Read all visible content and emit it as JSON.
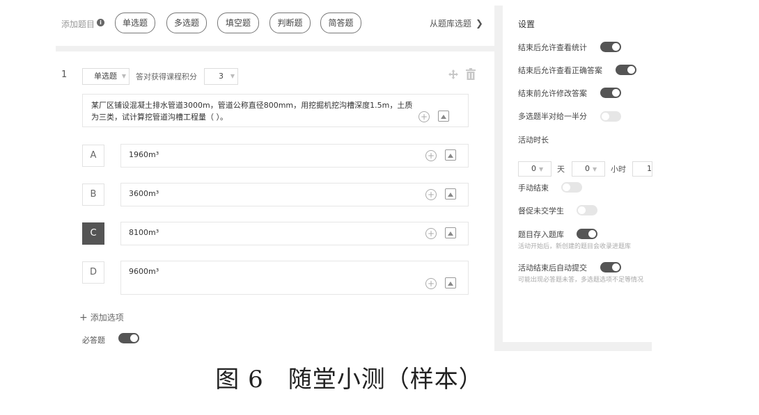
{
  "toolbar": {
    "add_label": "添加题目",
    "info_icon": "info-icon",
    "types": [
      "单选题",
      "多选题",
      "填空题",
      "判断题",
      "简答题"
    ],
    "bank_link": "从题库选题"
  },
  "question": {
    "number": "1",
    "type": "单选题",
    "points_label": "答对获得课程积分",
    "points": "3",
    "stem": "某厂区铺设混凝土排水管道3000m，管道公称直径800mm，用挖掘机挖沟槽深度1.5m，土质为三类，试计算挖管道沟槽工程量（ ）。",
    "options": [
      {
        "letter": "A",
        "text": "1960m³",
        "selected": false
      },
      {
        "letter": "B",
        "text": "3600m³",
        "selected": false
      },
      {
        "letter": "C",
        "text": "8100m³",
        "selected": true
      },
      {
        "letter": "D",
        "text": "9600m³",
        "selected": false
      }
    ],
    "add_option": "添加选项",
    "required_label": "必答题",
    "required": true
  },
  "settings": {
    "title": "设置",
    "items": [
      {
        "label": "结束后允许查看统计",
        "on": true
      },
      {
        "label": "结束后允许查看正确答案",
        "on": true
      },
      {
        "label": "结束前允许修改答案",
        "on": true
      },
      {
        "label": "多选题半对给一半分",
        "on": false
      }
    ],
    "duration_label": "活动时长",
    "duration": {
      "days": "0",
      "day_unit": "天",
      "hours": "0",
      "hour_unit": "小时",
      "minutes": "1"
    },
    "manual_end": {
      "label": "手动结束",
      "on": false
    },
    "remind": {
      "label": "督促未交学生",
      "on": false
    },
    "save_bank": {
      "label": "题目存入题库",
      "on": true,
      "sub": "活动开始后，新创建的题目会收录进题库"
    },
    "auto_submit": {
      "label": "活动结束后自动提交",
      "on": true,
      "sub": "可能出现必答题未答，多选题选项不足等情况"
    }
  },
  "caption": "图 6　随堂小测（样本）",
  "colors": {
    "toggle_on": "#555555",
    "toggle_off": "#e6e6e6",
    "selected_option": "#555555"
  }
}
